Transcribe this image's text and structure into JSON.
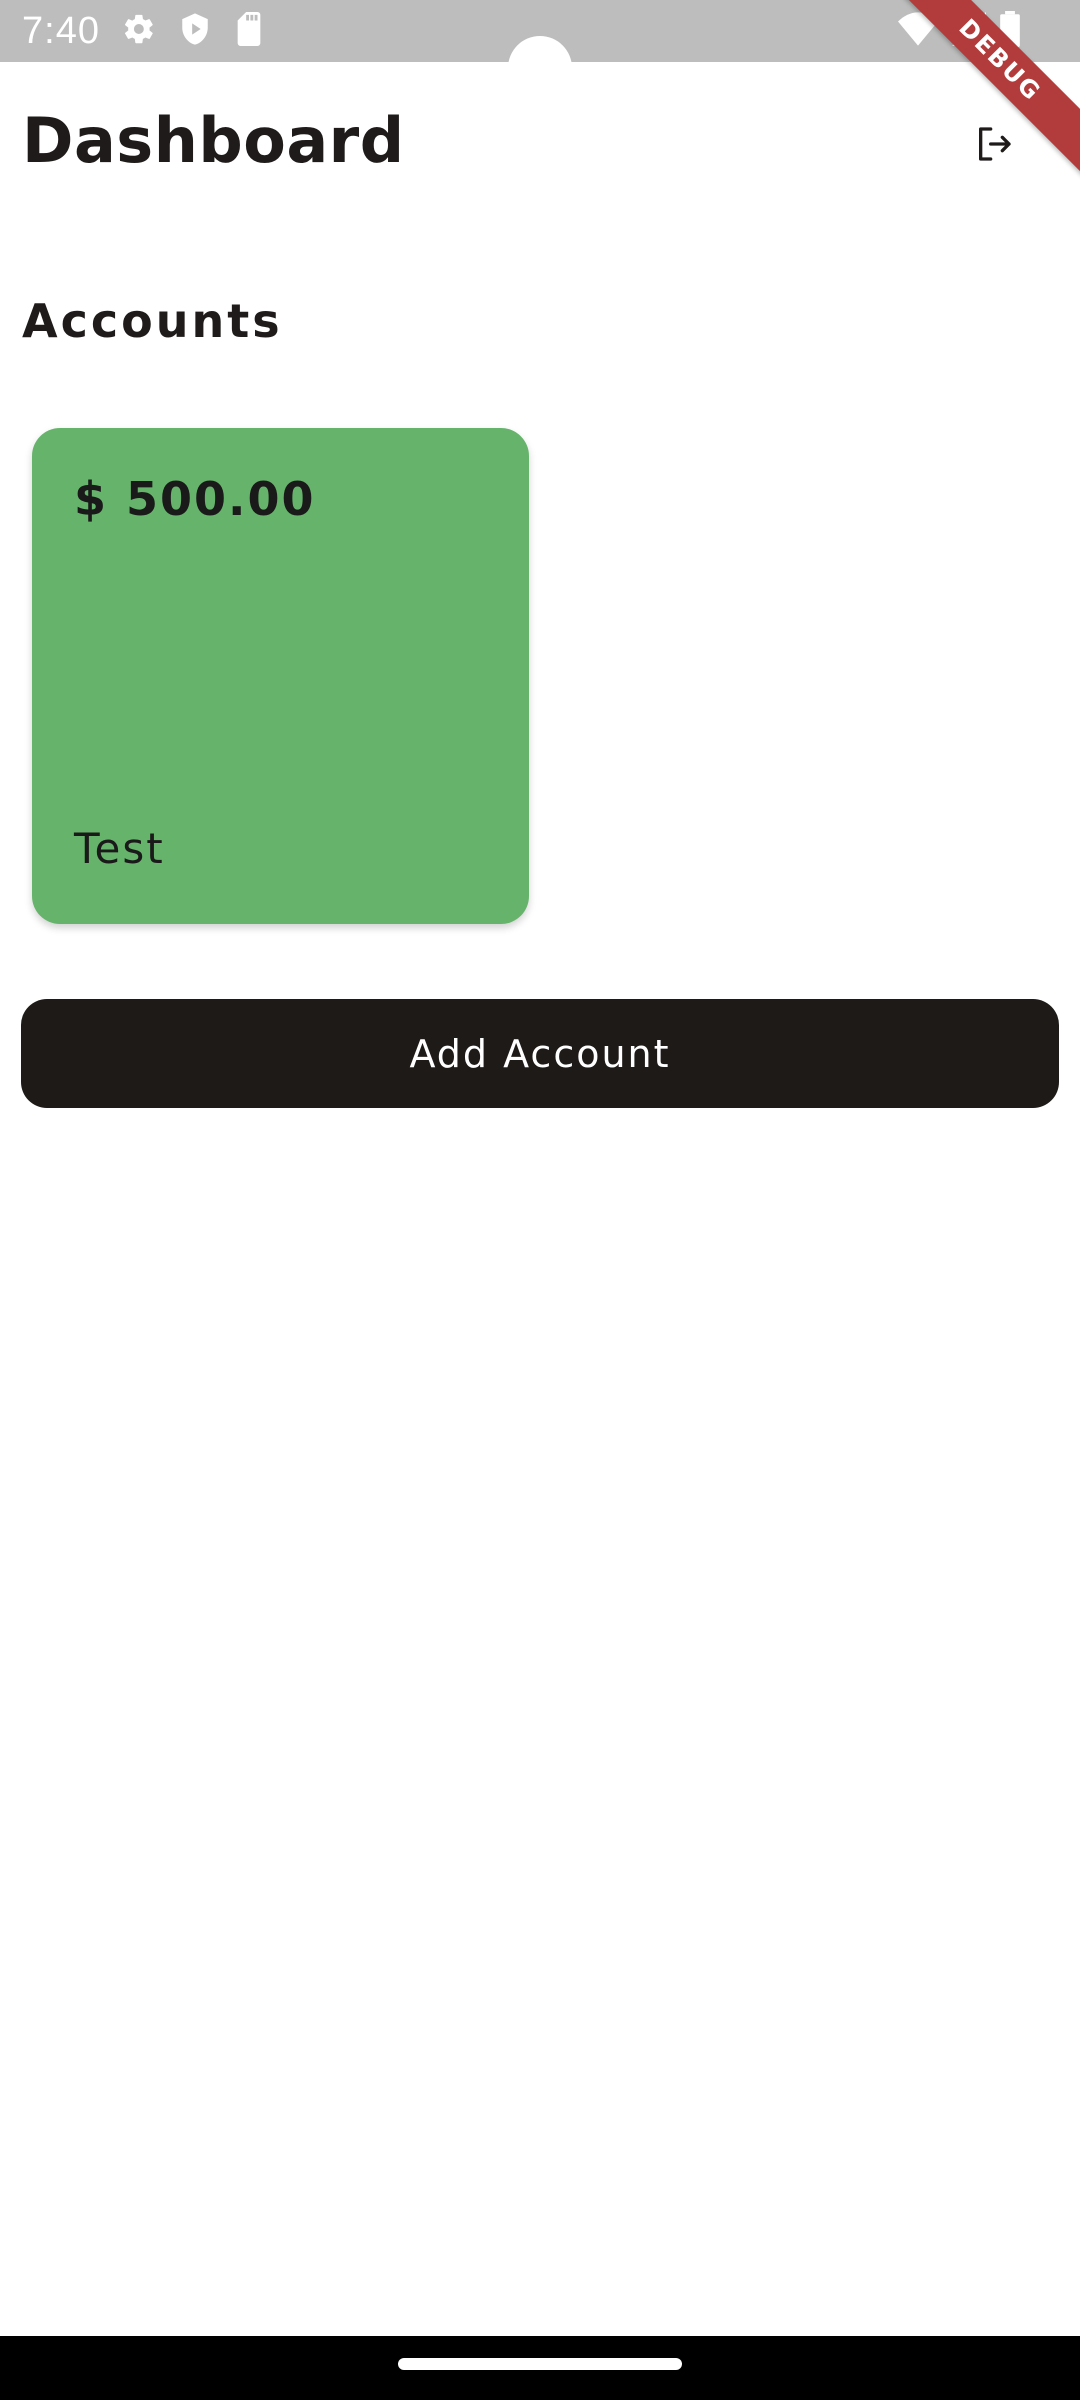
{
  "status_bar": {
    "time": "7:40",
    "icons_left": [
      "gear-icon",
      "shield-play-icon",
      "sd-card-icon"
    ],
    "icons_right": [
      "wifi-icon",
      "signal-icon",
      "battery-icon"
    ]
  },
  "debug_banner": {
    "label": "DEBUG",
    "color": "#b23b3b"
  },
  "header": {
    "title": "Dashboard",
    "logout_icon": "logout-icon"
  },
  "accounts_section": {
    "title": "Accounts",
    "accounts": [
      {
        "balance": "$ 500.00",
        "name": "Test",
        "color": "#66b46b"
      }
    ]
  },
  "add_account_button": {
    "label": "Add Account",
    "color": "#1e1a18"
  }
}
